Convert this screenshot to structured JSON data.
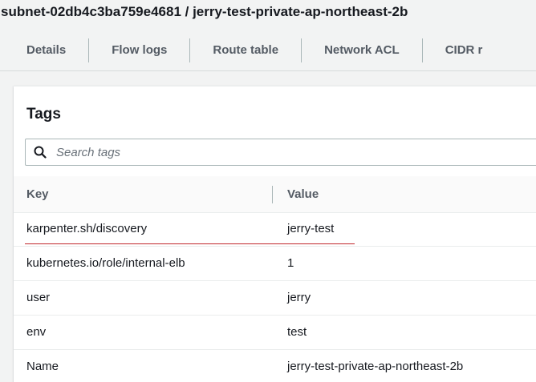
{
  "header": {
    "title": "subnet-02db4c3ba759e4681 / jerry-test-private-ap-northeast-2b"
  },
  "tabs": [
    {
      "label": "Details"
    },
    {
      "label": "Flow logs"
    },
    {
      "label": "Route table"
    },
    {
      "label": "Network ACL"
    },
    {
      "label": "CIDR r"
    }
  ],
  "tags_panel": {
    "title": "Tags",
    "search": {
      "placeholder": "Search tags",
      "value": "",
      "icon": "search-icon"
    },
    "columns": {
      "key": "Key",
      "value": "Value"
    },
    "rows": [
      {
        "key": "karpenter.sh/discovery",
        "value": "jerry-test"
      },
      {
        "key": "kubernetes.io/role/internal-elb",
        "value": "1"
      },
      {
        "key": "user",
        "value": "jerry"
      },
      {
        "key": "env",
        "value": "test"
      },
      {
        "key": "Name",
        "value": "jerry-test-private-ap-northeast-2b"
      }
    ]
  },
  "colors": {
    "annotation_underline": "#c0262a",
    "tab_text": "#545b64",
    "border": "#aab7b8"
  }
}
